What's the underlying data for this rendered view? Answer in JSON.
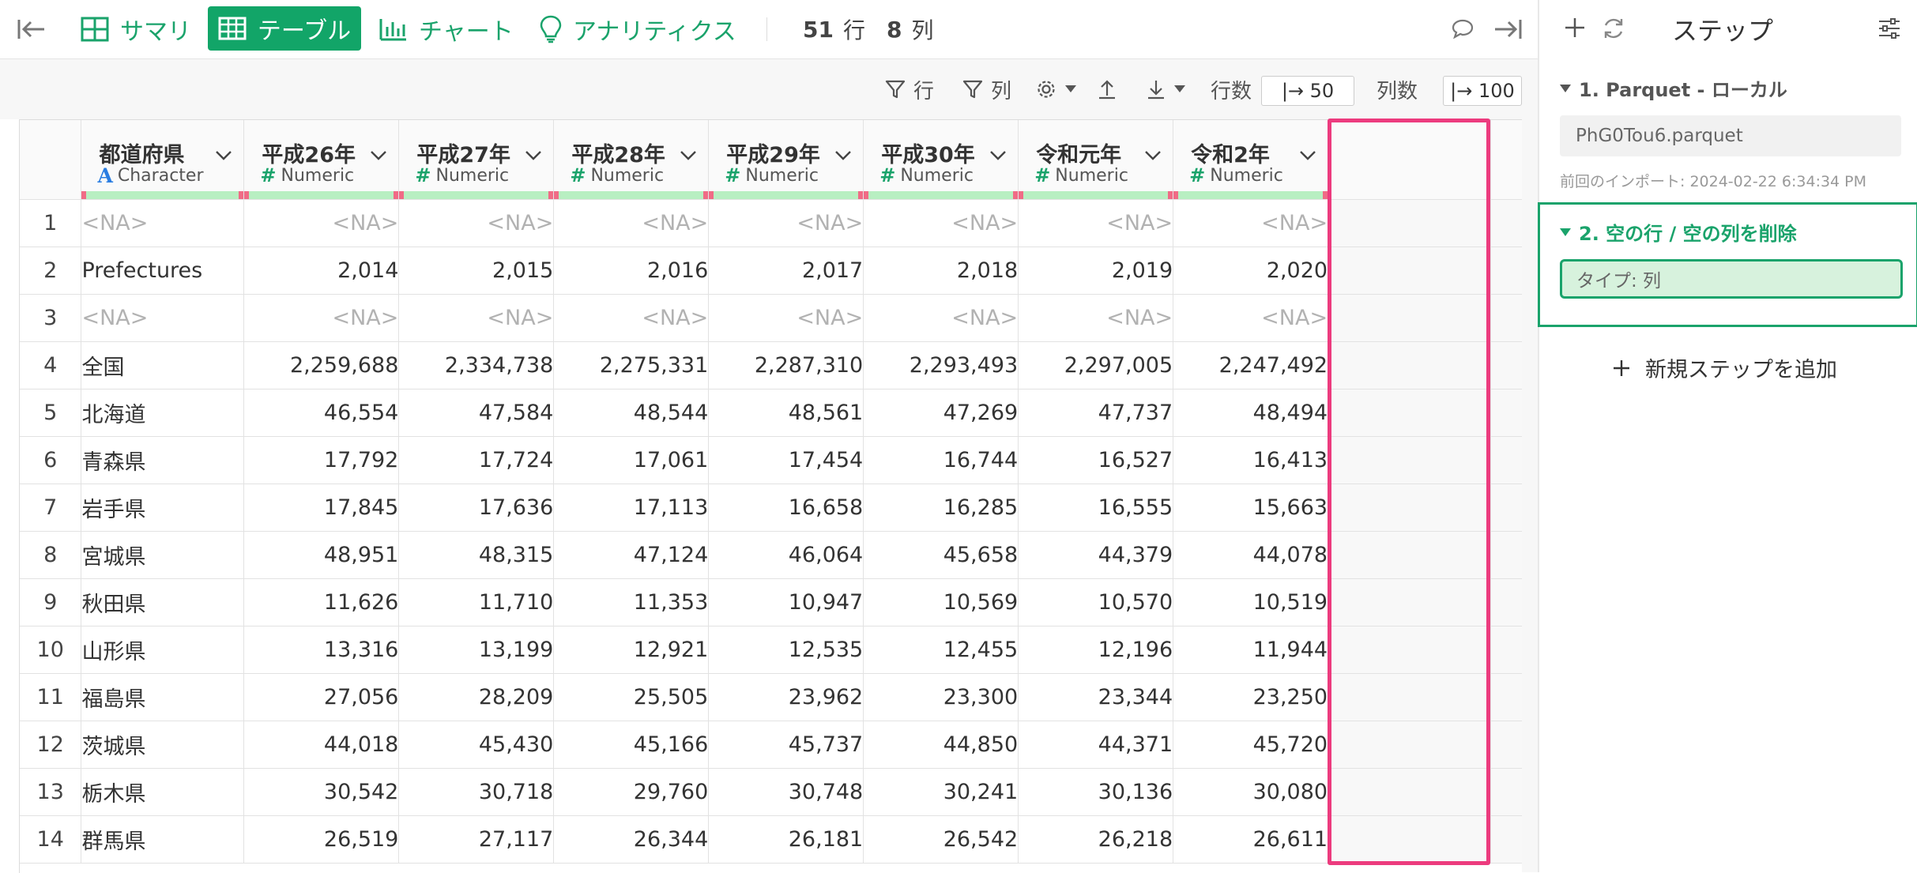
{
  "toolbar": {
    "tabs": [
      {
        "label": "サマリ",
        "icon": "summary-grid-icon"
      },
      {
        "label": "テーブル",
        "icon": "table-icon",
        "active": true
      },
      {
        "label": "チャート",
        "icon": "bar-chart-icon"
      },
      {
        "label": "アナリティクス",
        "icon": "lightbulb-icon"
      }
    ],
    "row_count": "51",
    "row_unit": "行",
    "col_count": "8",
    "col_unit": "列"
  },
  "subtoolbar": {
    "filter_row_label": "行",
    "filter_col_label": "列",
    "rows_label": "行数",
    "rows_value": "|→ 50",
    "cols_label": "列数",
    "cols_value": "|→ 100"
  },
  "table": {
    "columns": [
      {
        "name": "都道府県",
        "type": "Character"
      },
      {
        "name": "平成26年",
        "type": "Numeric"
      },
      {
        "name": "平成27年",
        "type": "Numeric"
      },
      {
        "name": "平成28年",
        "type": "Numeric"
      },
      {
        "name": "平成29年",
        "type": "Numeric"
      },
      {
        "name": "平成30年",
        "type": "Numeric"
      },
      {
        "name": "令和元年",
        "type": "Numeric"
      },
      {
        "name": "令和2年",
        "type": "Numeric"
      }
    ],
    "rows": [
      [
        "1",
        "<NA>",
        "<NA>",
        "<NA>",
        "<NA>",
        "<NA>",
        "<NA>",
        "<NA>",
        "<NA>"
      ],
      [
        "2",
        "Prefectures",
        "2,014",
        "2,015",
        "2,016",
        "2,017",
        "2,018",
        "2,019",
        "2,020"
      ],
      [
        "3",
        "<NA>",
        "<NA>",
        "<NA>",
        "<NA>",
        "<NA>",
        "<NA>",
        "<NA>",
        "<NA>"
      ],
      [
        "4",
        "全国",
        "2,259,688",
        "2,334,738",
        "2,275,331",
        "2,287,310",
        "2,293,493",
        "2,297,005",
        "2,247,492"
      ],
      [
        "5",
        "北海道",
        "46,554",
        "47,584",
        "48,544",
        "48,561",
        "47,269",
        "47,737",
        "48,494"
      ],
      [
        "6",
        "青森県",
        "17,792",
        "17,724",
        "17,061",
        "17,454",
        "16,744",
        "16,527",
        "16,413"
      ],
      [
        "7",
        "岩手県",
        "17,845",
        "17,636",
        "17,113",
        "16,658",
        "16,285",
        "16,555",
        "15,663"
      ],
      [
        "8",
        "宮城県",
        "48,951",
        "48,315",
        "47,124",
        "46,064",
        "45,658",
        "44,379",
        "44,078"
      ],
      [
        "9",
        "秋田県",
        "11,626",
        "11,710",
        "11,353",
        "10,947",
        "10,569",
        "10,570",
        "10,519"
      ],
      [
        "10",
        "山形県",
        "13,316",
        "13,199",
        "12,921",
        "12,535",
        "12,455",
        "12,196",
        "11,944"
      ],
      [
        "11",
        "福島県",
        "27,056",
        "28,209",
        "25,505",
        "23,962",
        "23,300",
        "23,344",
        "23,250"
      ],
      [
        "12",
        "茨城県",
        "44,018",
        "45,430",
        "45,166",
        "45,737",
        "44,850",
        "44,371",
        "45,720"
      ],
      [
        "13",
        "栃木県",
        "30,542",
        "30,718",
        "29,760",
        "30,748",
        "30,241",
        "30,136",
        "30,080"
      ],
      [
        "14",
        "群馬県",
        "26,519",
        "27,117",
        "26,344",
        "26,181",
        "26,542",
        "26,218",
        "26,611"
      ]
    ]
  },
  "side": {
    "title": "ステップ",
    "step1_title": "1. Parquet - ローカル",
    "step1_file": "PhG0Tou6.parquet",
    "step1_meta": "前回のインポート: 2024-02-22 6:34:34 PM",
    "step2_title": "2. 空の行 / 空の列を削除",
    "step2_field": "タイプ: 列",
    "add_step": "新規ステップを追加"
  },
  "colors": {
    "accent": "#12a568",
    "highlight": "#ec3b7e"
  }
}
